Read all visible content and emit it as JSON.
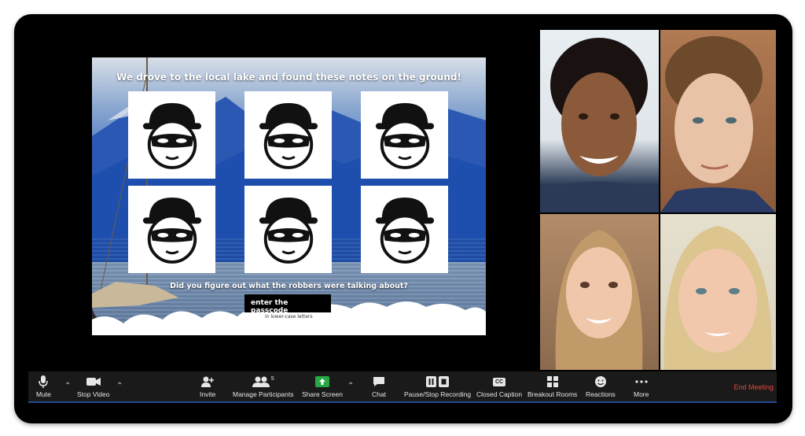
{
  "slide": {
    "title": "We drove to the local lake and found these notes on the ground!",
    "question": "Did you figure out what the robbers were talking about?",
    "passcode_label": "enter the passcode",
    "hint": "in lower-case letters",
    "tiles": [
      "robber-face",
      "robber-face",
      "robber-face",
      "robber-face",
      "robber-face",
      "robber-face"
    ]
  },
  "participants": [
    {
      "tile": "participant-1"
    },
    {
      "tile": "participant-2"
    },
    {
      "tile": "participant-3"
    },
    {
      "tile": "participant-4"
    }
  ],
  "toolbar": {
    "mute": "Mute",
    "stop_video": "Stop Video",
    "invite": "Invite",
    "manage_participants": "Manage Participants",
    "participant_count": "5",
    "share_screen": "Share Screen",
    "chat": "Chat",
    "pause_recording": "Pause/Stop Recording",
    "closed_caption": "Closed Caption",
    "cc_badge": "CC",
    "breakout_rooms": "Breakout Rooms",
    "reactions": "Reactions",
    "more": "More",
    "end_meeting": "End Meeting"
  },
  "colors": {
    "end_meeting": "#e8463b",
    "share_green": "#27a844",
    "toolbar_bg": "#1a1a1a"
  }
}
